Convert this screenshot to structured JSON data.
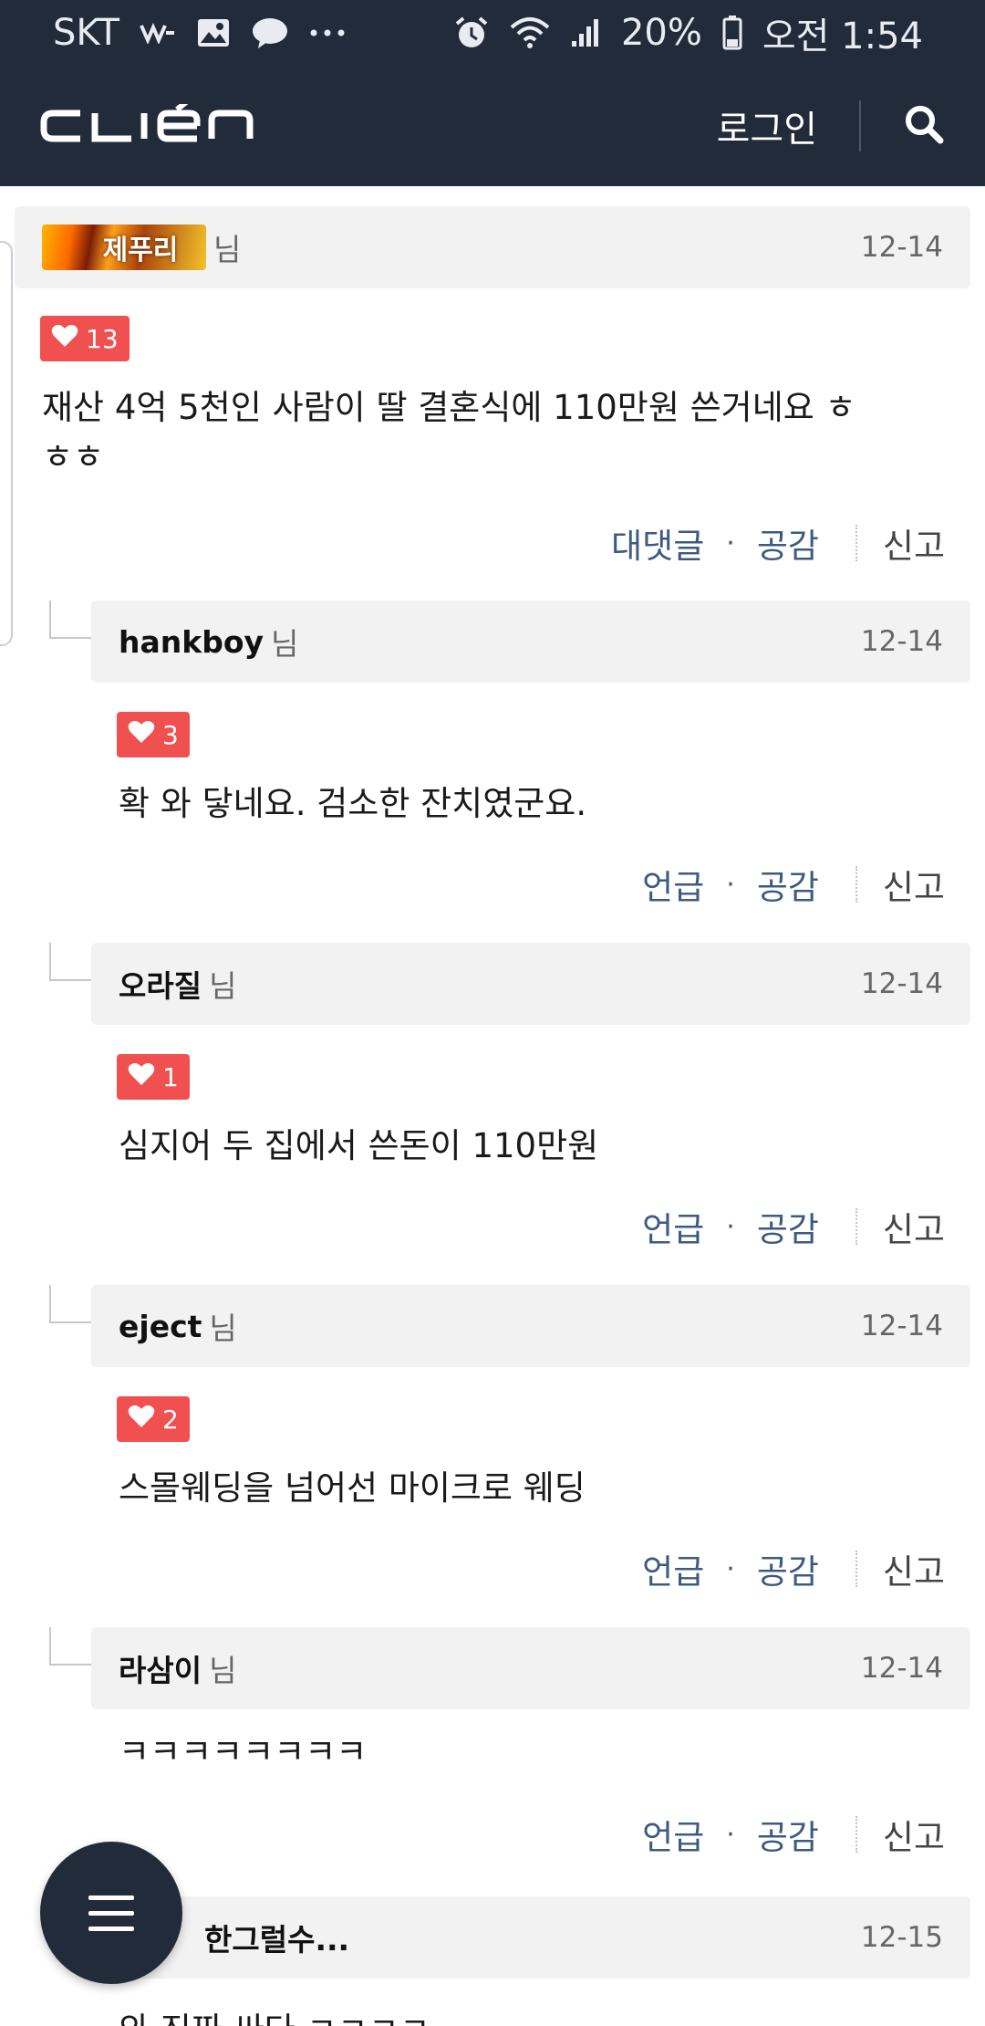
{
  "status_bar": {
    "carrier": "SKT",
    "battery": "20%",
    "time": "오전 1:54"
  },
  "header": {
    "logo_text": "CLIEN",
    "login_label": "로그인"
  },
  "comments": [
    {
      "badge_nick": "제푸리",
      "name": "",
      "suffix": "님",
      "date": "12-14",
      "likes": "13",
      "body_line1": "재산 4억 5천인 사람이 딸 결혼식에 110만원 쓴거네요  ㅎ",
      "body_line2": "ㅎㅎ",
      "action1": "대댓글",
      "action2": "공감",
      "report": "신고"
    },
    {
      "name": "hankboy",
      "suffix": "님",
      "date": "12-14",
      "likes": "3",
      "body": "확 와 닿네요. 검소한 잔치였군요.",
      "action1": "언급",
      "action2": "공감",
      "report": "신고"
    },
    {
      "name": "오라질",
      "suffix": "님",
      "date": "12-14",
      "likes": "1",
      "body": "심지어 두 집에서 쓴돈이 110만원",
      "action1": "언급",
      "action2": "공감",
      "report": "신고"
    },
    {
      "name": "eject",
      "suffix": "님",
      "date": "12-14",
      "likes": "2",
      "body": "스몰웨딩을 넘어선 마이크로 웨딩",
      "action1": "언급",
      "action2": "공감",
      "report": "신고"
    },
    {
      "name": "라삼이",
      "suffix": "님",
      "date": "12-14",
      "body": "ㅋㅋㅋㅋㅋㅋㅋㅋ",
      "action1": "언급",
      "action2": "공감",
      "report": "신고"
    },
    {
      "name": "한그럴수...",
      "date": "12-15",
      "body": "와 진짜 싸다 ㅋㅋㅋㅋ"
    }
  ],
  "colors": {
    "header_bg": "#222b3a",
    "like_badge": "#f05050",
    "action_link": "#3d5a80",
    "comment_head_bg": "#f2f2f3"
  },
  "icons": {
    "search": "search-icon",
    "menu": "menu-icon",
    "heart": "heart-icon"
  }
}
